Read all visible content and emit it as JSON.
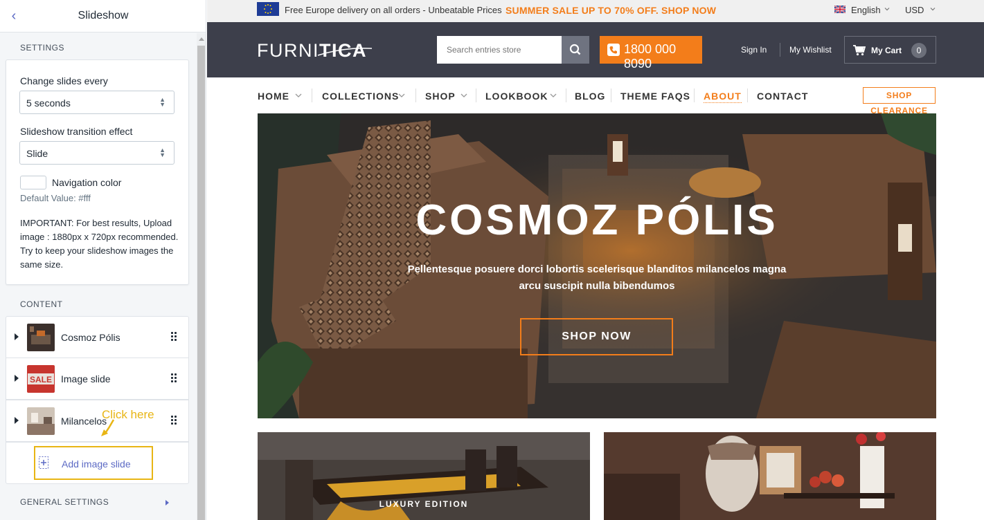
{
  "sidebar": {
    "title": "Slideshow",
    "settings_heading": "SETTINGS",
    "change_slides_label": "Change slides every",
    "change_slides_value": "5 seconds",
    "transition_label": "Slideshow transition effect",
    "transition_value": "Slide",
    "nav_color_label": "Navigation color",
    "nav_color_value": "#ffffff",
    "nav_color_default": "Default Value: #fff",
    "important_note": "IMPORTANT: For best results, Upload image : 1880px x 720px recommended. Try to keep your slideshow images the same size.",
    "content_heading": "CONTENT",
    "slides": [
      {
        "name": "Cosmoz Pólis",
        "thumb": "furniture-photo"
      },
      {
        "name": "Image slide",
        "thumb": "sale-sign-photo"
      },
      {
        "name": "Milancelos",
        "thumb": "room-photo"
      }
    ],
    "add_slide_label": "Add image slide",
    "annotation": "Click here",
    "general_settings_heading": "GENERAL SETTINGS",
    "accent_color": "#5c6ac4",
    "highlight_color": "#e8b514"
  },
  "store": {
    "topbar": {
      "free_delivery": "Free Europe delivery on all orders - Unbeatable Prices",
      "promo": "SUMMER SALE UP TO 70% OFF. SHOP NOW",
      "language": "English",
      "currency": "USD"
    },
    "header": {
      "logo_light": "FURNI",
      "logo_bold": "TICA",
      "search_placeholder": "Search entries store",
      "phone": "1800 000 8090",
      "sign_in": "Sign In",
      "wishlist": "My Wishlist",
      "cart_label": "My Cart",
      "cart_count": "0"
    },
    "nav": {
      "items": [
        "HOME",
        "COLLECTIONS",
        "SHOP",
        "LOOKBOOK",
        "BLOG",
        "THEME FAQS",
        "ABOUT",
        "CONTACT"
      ],
      "active": "ABOUT",
      "clearance": "SHOP CLEARANCE"
    },
    "hero": {
      "title": "COSMOZ PÓLIS",
      "subtitle": "Pellentesque posuere dorci lobortis scelerisque blanditos milancelos magna arcu suscipit nulla bibendumos",
      "button": "SHOP NOW"
    },
    "tiles": [
      {
        "label": "LUXURY EDITION"
      },
      {
        "label": ""
      }
    ],
    "colors": {
      "orange": "#f37d1a",
      "header_bg": "#3d3f4b",
      "topbar_bg": "#f0f0f0"
    }
  }
}
